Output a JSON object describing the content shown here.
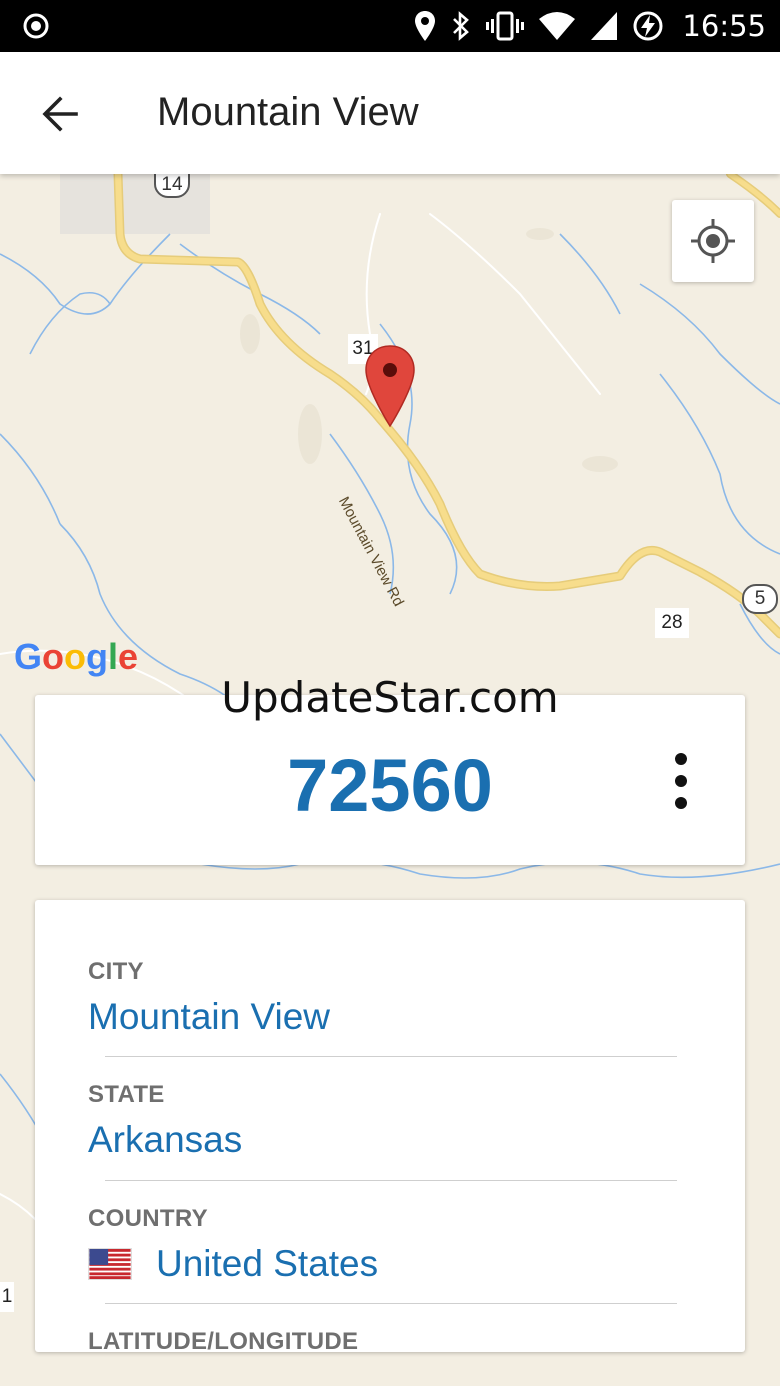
{
  "status_bar": {
    "time": "16:55",
    "icons": [
      "location-pin-icon",
      "bluetooth-icon",
      "vibrate-icon",
      "wifi-icon",
      "cell-signal-icon",
      "battery-charging-icon"
    ]
  },
  "app_bar": {
    "title": "Mountain View",
    "back_icon": "arrow-back-icon"
  },
  "map": {
    "road_labels": {
      "route_14": "14",
      "route_31": "31",
      "road_name": "Mountain View Rd",
      "route_5": "5",
      "route_28": "28",
      "edge_label": "1"
    },
    "logo_text": "Google",
    "locate_icon": "my-location-icon",
    "marker_icon": "map-pin-icon"
  },
  "watermark": "UpdateStar.com",
  "zip_card": {
    "zip": "72560",
    "menu_icon": "more-vertical-icon"
  },
  "details": {
    "city_label": "CITY",
    "city_value": "Mountain View",
    "state_label": "STATE",
    "state_value": "Arkansas",
    "country_label": "COUNTRY",
    "country_value": "United States",
    "country_flag_icon": "us-flag-icon",
    "latlon_label": "LATITUDE/LONGITUDE"
  },
  "colors": {
    "accent": "#1a6fb0",
    "map_bg": "#f3eee2",
    "road": "#f7dd8c",
    "water": "#8bb8e8",
    "marker": "#e0463c"
  }
}
